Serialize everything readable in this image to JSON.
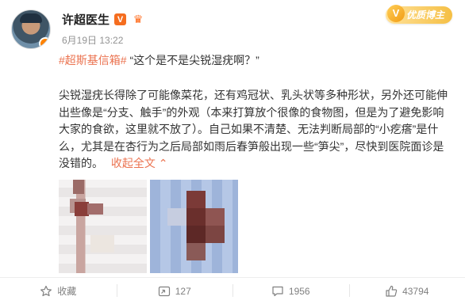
{
  "post": {
    "author": "许超医生",
    "vip_mark": "V",
    "date": "6月19日",
    "time": "13:22",
    "quality_badge": "优质博主",
    "topic": "#超斯基信箱#",
    "question": "“这个是不是尖锐湿疣啊？”",
    "body": "尖锐湿疣长得除了可能像菜花，还有鸡冠状、乳头状等多种形状，另外还可能伸出些像是“分支、触手”的外观（本来打算放个很像的食物图，但是为了避免影响大家的食欲，这里就不放了）。自己如果不清楚、无法判断局部的“小疙瘩”是什么，尤其是在杏行为之后局部如雨后春笋般出现一些“笋尖”，尽快到医院面诊是没错的。",
    "collapse_label": "收起全文",
    "collapse_icon": "chevron-up-icon"
  },
  "footer": {
    "favorite_label": "收藏",
    "repost_count": "127",
    "comment_count": "1956",
    "like_count": "43794"
  },
  "colors": {
    "accent": "#eb7350",
    "vip": "#f56d1f",
    "gold": "#f5bf44",
    "muted": "#939393"
  }
}
